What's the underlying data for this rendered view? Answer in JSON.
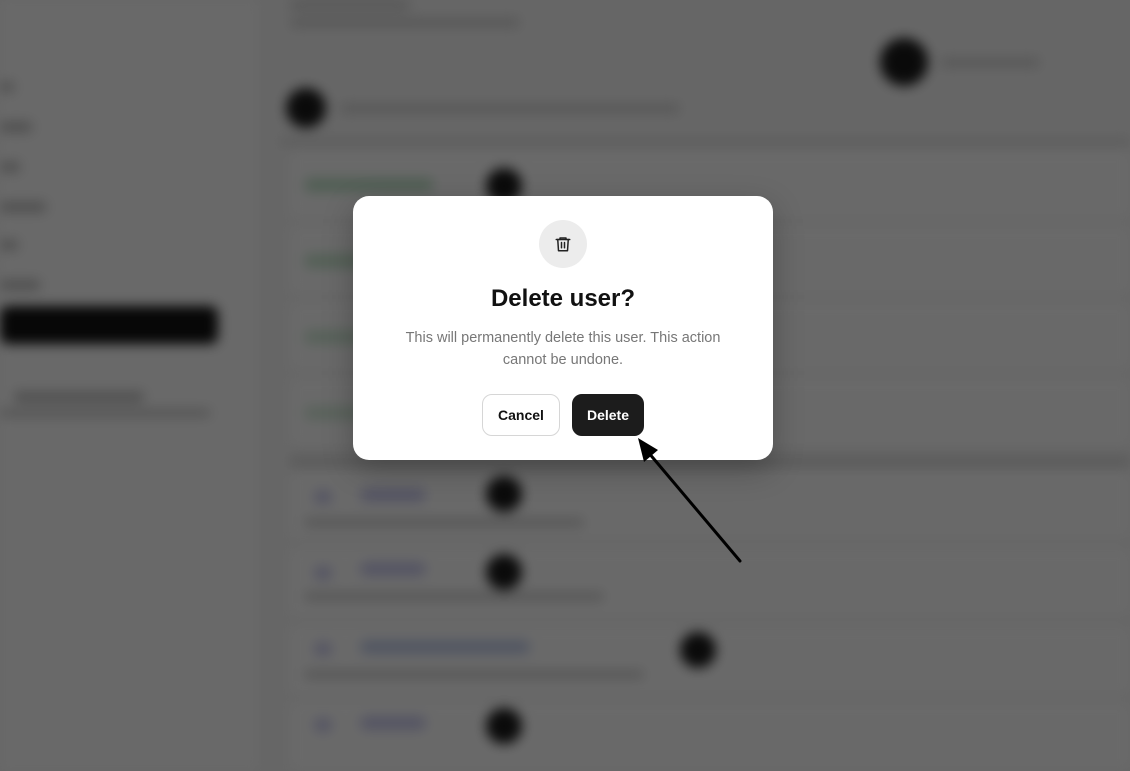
{
  "dialog": {
    "icon": "trash-icon",
    "title": "Delete user?",
    "message": "This will permanently delete this user. This action cannot be undone.",
    "cancel_label": "Cancel",
    "delete_label": "Delete"
  },
  "annotation": {
    "type": "arrow",
    "points_to": "delete-button"
  },
  "colors": {
    "overlay": "#000000",
    "primary_button": "#1c1c1c",
    "icon_bg": "#ececec"
  }
}
